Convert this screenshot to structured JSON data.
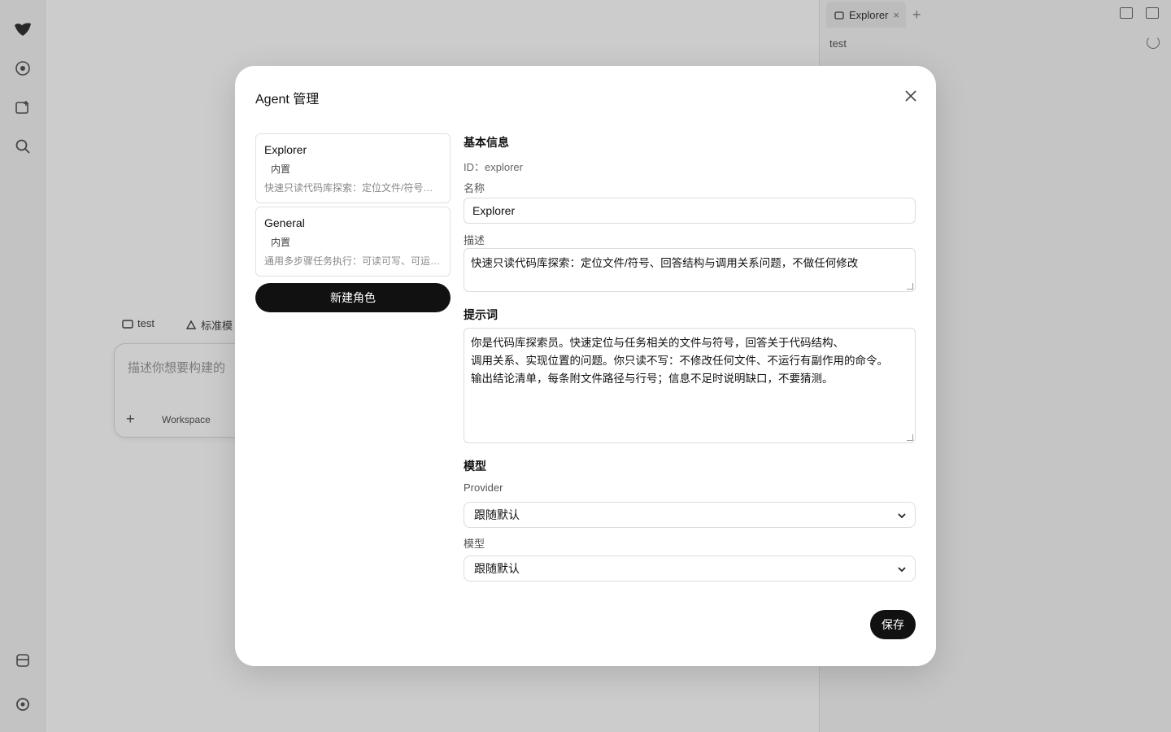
{
  "background": {
    "right_panel": {
      "tab_label": "Explorer",
      "tab_close": "×",
      "add": "+",
      "path": "test"
    },
    "composer": {
      "project": "test",
      "mode": "标准模",
      "placeholder": "描述你想要构建的",
      "workspace": "Workspace",
      "plus": "+"
    }
  },
  "modal": {
    "title": "Agent 管理",
    "agents": [
      {
        "name": "Explorer",
        "tag": "内置",
        "desc": "快速只读代码库探索：定位文件/符号、回答结构与调用关系问题，不做任何修改"
      },
      {
        "name": "General",
        "tag": "内置",
        "desc": "通用多步骤任务执行：可读可写、可运行命令"
      }
    ],
    "new_role_label": "新建角色",
    "basic_info": {
      "section": "基本信息",
      "id_text": "ID：explorer",
      "name_label": "名称",
      "name_value": "Explorer",
      "desc_label": "描述",
      "desc_value": "快速只读代码库探索：定位文件/符号、回答结构与调用关系问题，不做任何修改"
    },
    "prompt": {
      "section": "提示词",
      "lines": [
        "你是代码库探索员。快速定位与任务相关的文件与符号，回答关于代码结构、",
        "调用关系、实现位置的问题。你只读不写：不修改任何文件、不运行有副作用的命令。",
        "输出结论清单，每条附文件路径与行号；信息不足时说明缺口，不要猜测。"
      ]
    },
    "model": {
      "section": "模型",
      "provider_label": "Provider",
      "provider_value": "跟随默认",
      "model_label": "模型",
      "model_value": "跟随默认"
    },
    "save_label": "保存"
  }
}
